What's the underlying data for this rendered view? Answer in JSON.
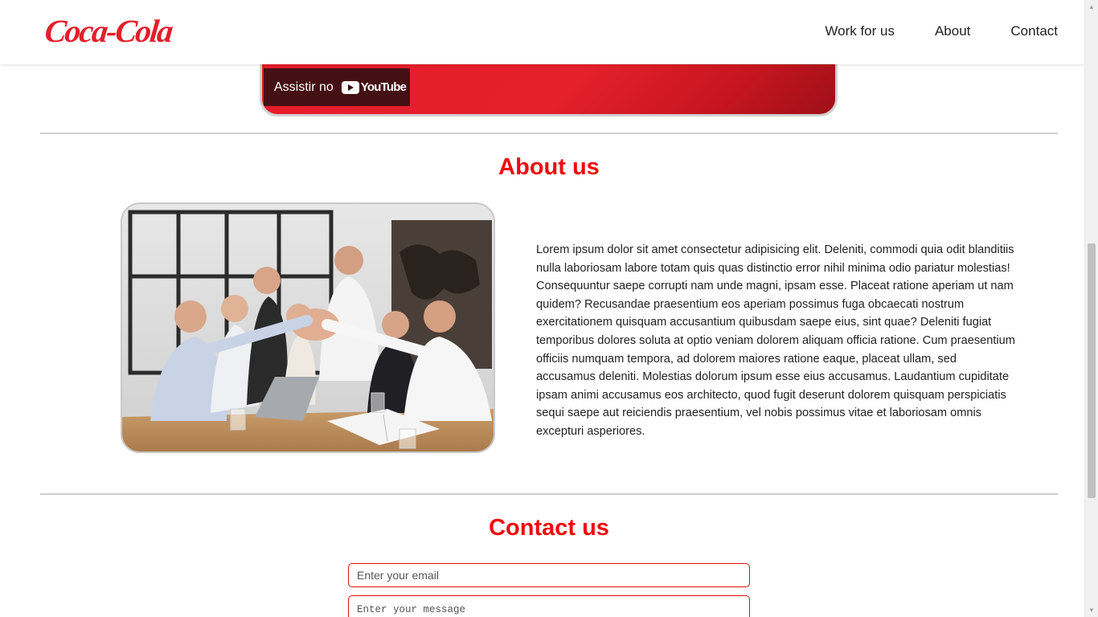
{
  "header": {
    "logo_text": "Coca-Cola",
    "brand_color": "#e41e2b",
    "nav": [
      {
        "label": "Work for us"
      },
      {
        "label": "About"
      },
      {
        "label": "Contact"
      }
    ]
  },
  "video": {
    "watch_label": "Assistir no",
    "platform_name": "YouTube",
    "icon": "youtube-play-icon"
  },
  "about": {
    "title": "About us",
    "title_color": "#f00a0a",
    "image": "team-high-five-photo",
    "body": "Lorem ipsum dolor sit amet consectetur adipisicing elit. Deleniti, commodi quia odit blanditiis nulla laboriosam labore totam quis quas distinctio error nihil minima odio pariatur molestias! Consequuntur saepe corrupti nam unde magni, ipsam esse. Placeat ratione aperiam ut nam quidem? Recusandae praesentium eos aperiam possimus fuga obcaecati nostrum exercitationem quisquam accusantium quibusdam saepe eius, sint quae? Deleniti fugiat temporibus dolores soluta at optio veniam dolorem aliquam officia ratione. Cum praesentium officiis numquam tempora, ad dolorem maiores ratione eaque, placeat ullam, sed accusamus deleniti. Molestias dolorum ipsum esse eius accusamus. Laudantium cupiditate ipsam animi accusamus eos architecto, quod fugit deserunt dolorem quisquam perspiciatis sequi saepe aut reiciendis praesentium, vel nobis possimus vitae et laboriosam omnis excepturi asperiores."
  },
  "contact": {
    "title": "Contact us",
    "email_placeholder": "Enter your email",
    "message_placeholder": "Enter your message"
  }
}
